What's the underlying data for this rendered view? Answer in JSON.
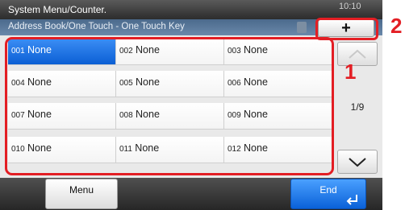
{
  "header": {
    "title": "System Menu/Counter.",
    "clock": "10:10"
  },
  "subheader": {
    "title": "Address Book/One Touch - One Touch Key"
  },
  "toolbar": {
    "add_icon": "plus-icon",
    "add_label": "+"
  },
  "keys": [
    {
      "number": "001",
      "name": "None",
      "selected": true
    },
    {
      "number": "002",
      "name": "None"
    },
    {
      "number": "003",
      "name": "None"
    },
    {
      "number": "004",
      "name": "None"
    },
    {
      "number": "005",
      "name": "None"
    },
    {
      "number": "006",
      "name": "None"
    },
    {
      "number": "007",
      "name": "None"
    },
    {
      "number": "008",
      "name": "None"
    },
    {
      "number": "009",
      "name": "None"
    },
    {
      "number": "010",
      "name": "None"
    },
    {
      "number": "011",
      "name": "None"
    },
    {
      "number": "012",
      "name": "None"
    }
  ],
  "pager": {
    "indicator": "1/9",
    "up_icon": "chevron-up-icon",
    "down_icon": "chevron-down-icon"
  },
  "footer": {
    "menu_label": "Menu",
    "end_label": "End",
    "end_icon": "enter-icon"
  },
  "callouts": {
    "grid": "1",
    "add": "2"
  },
  "colors": {
    "selected": "#0b5fd4",
    "callout": "#e31e24",
    "accent": "#1f6fe0"
  }
}
